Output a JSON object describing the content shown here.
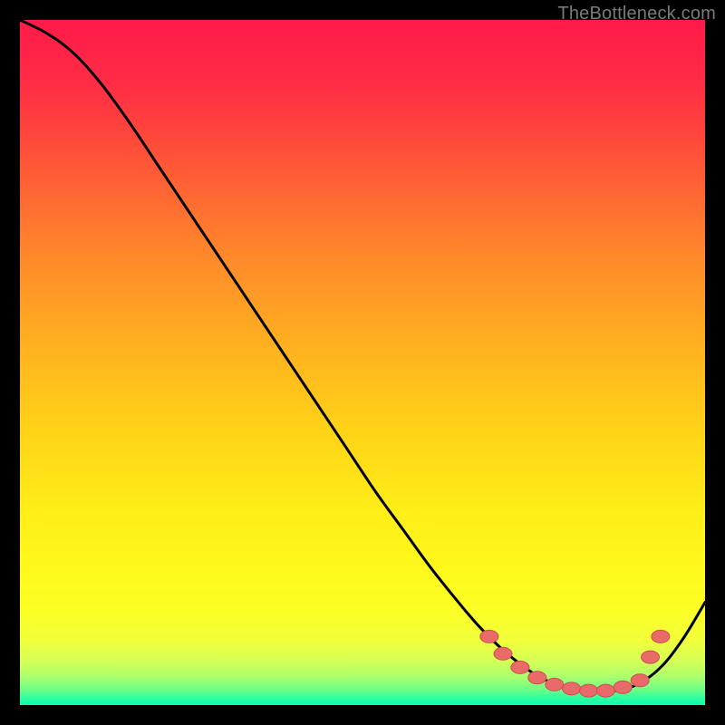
{
  "watermark": "TheBottleneck.com",
  "colors": {
    "frame": "#000000",
    "curve": "#000000",
    "dot_fill": "#ea6a6a",
    "dot_stroke": "#c94f4f",
    "gradient_stops": [
      {
        "offset": 0.0,
        "color": "#ff1a4a"
      },
      {
        "offset": 0.1,
        "color": "#ff2e44"
      },
      {
        "offset": 0.22,
        "color": "#ff5a36"
      },
      {
        "offset": 0.35,
        "color": "#ff8a2a"
      },
      {
        "offset": 0.48,
        "color": "#ffb21f"
      },
      {
        "offset": 0.6,
        "color": "#ffd318"
      },
      {
        "offset": 0.72,
        "color": "#ffee18"
      },
      {
        "offset": 0.8,
        "color": "#fff81c"
      },
      {
        "offset": 0.86,
        "color": "#fcff24"
      },
      {
        "offset": 0.905,
        "color": "#f1ff3a"
      },
      {
        "offset": 0.935,
        "color": "#d6ff56"
      },
      {
        "offset": 0.96,
        "color": "#a8ff6e"
      },
      {
        "offset": 0.978,
        "color": "#6bff88"
      },
      {
        "offset": 0.99,
        "color": "#2dffa0"
      },
      {
        "offset": 1.0,
        "color": "#0affb0"
      }
    ]
  },
  "chart_data": {
    "type": "line",
    "title": "",
    "xlabel": "",
    "ylabel": "",
    "xlim": [
      0,
      100
    ],
    "ylim": [
      0,
      100
    ],
    "grid": false,
    "series": [
      {
        "name": "bottleneck-curve",
        "x": [
          0,
          4,
          8,
          12,
          16,
          20,
          24,
          28,
          32,
          36,
          40,
          44,
          48,
          52,
          56,
          60,
          64,
          67,
          70,
          73,
          76,
          79,
          82,
          85,
          88,
          91,
          94,
          97,
          100
        ],
        "y": [
          100.0,
          98.0,
          95.0,
          90.5,
          85.0,
          79.0,
          73.0,
          67.0,
          61.0,
          55.0,
          49.0,
          43.0,
          37.0,
          31.0,
          25.5,
          20.0,
          15.0,
          11.5,
          8.5,
          6.0,
          4.0,
          2.8,
          2.2,
          2.0,
          2.3,
          3.5,
          6.0,
          10.0,
          15.0
        ]
      }
    ],
    "annotations": {
      "dots": [
        {
          "x": 68.5,
          "y": 10.0
        },
        {
          "x": 70.5,
          "y": 7.5
        },
        {
          "x": 73.0,
          "y": 5.5
        },
        {
          "x": 75.5,
          "y": 4.0
        },
        {
          "x": 78.0,
          "y": 3.0
        },
        {
          "x": 80.5,
          "y": 2.4
        },
        {
          "x": 83.0,
          "y": 2.1
        },
        {
          "x": 85.5,
          "y": 2.1
        },
        {
          "x": 88.0,
          "y": 2.6
        },
        {
          "x": 90.5,
          "y": 3.6
        },
        {
          "x": 92.0,
          "y": 7.0
        },
        {
          "x": 93.5,
          "y": 10.0
        }
      ]
    }
  }
}
